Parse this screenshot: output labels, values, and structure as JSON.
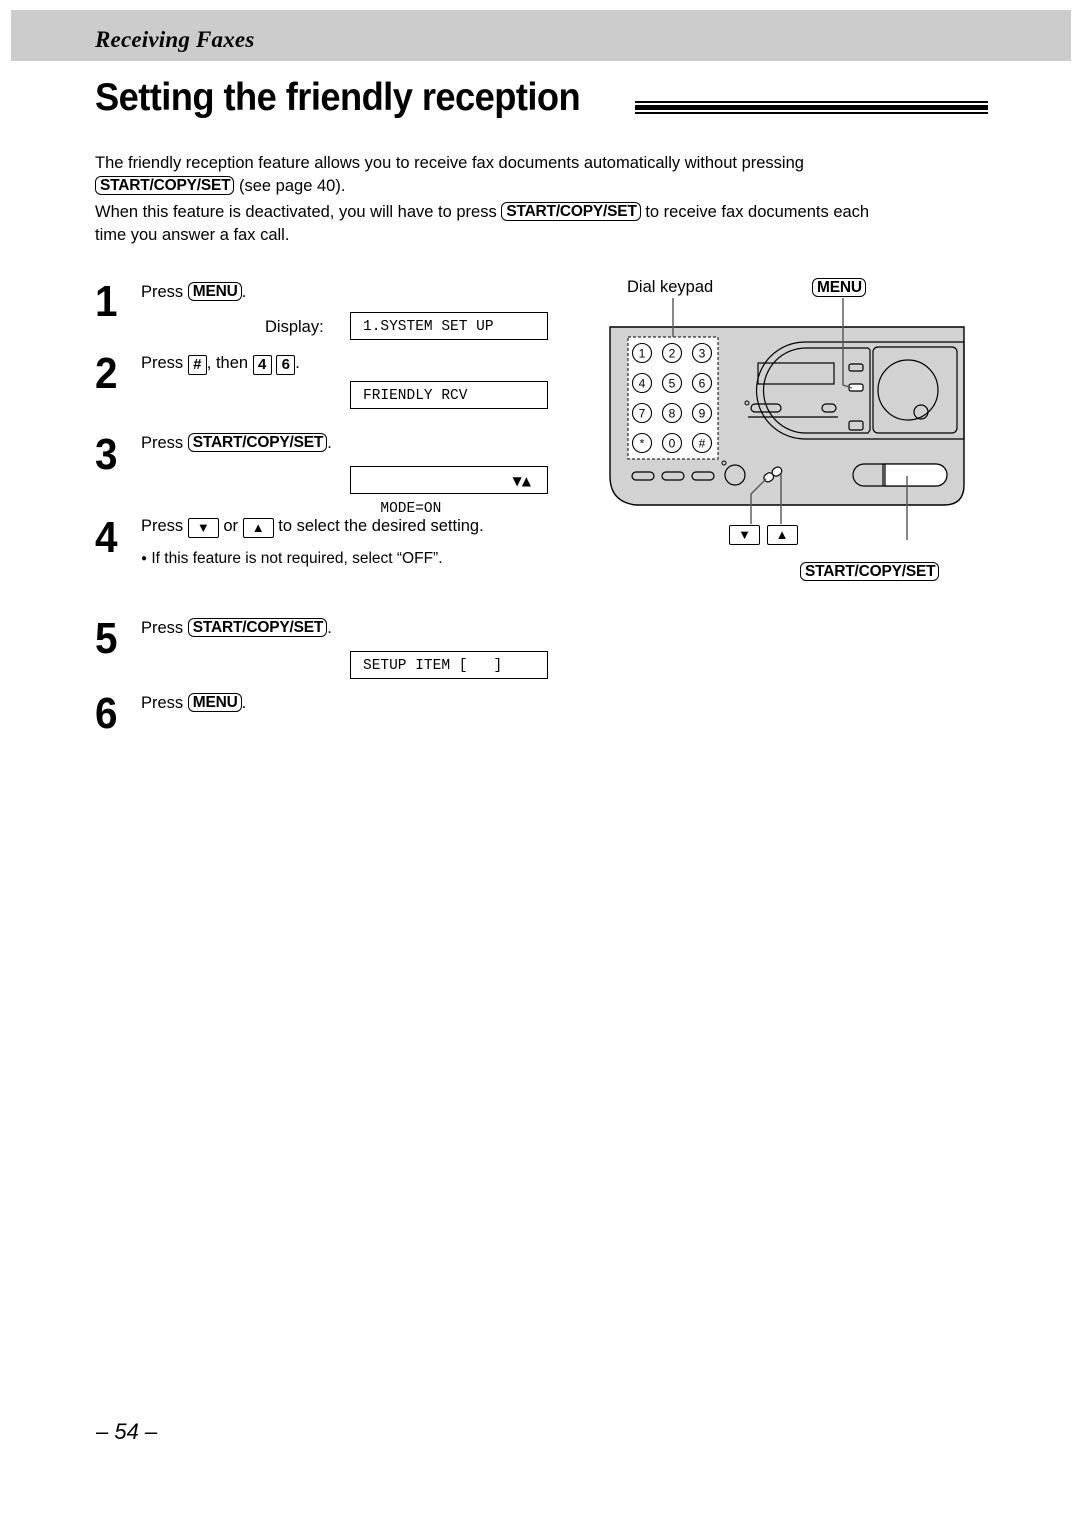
{
  "section": {
    "title": "Receiving Faxes"
  },
  "page_title": "Setting the friendly reception",
  "intro": {
    "line1": "The friendly reception feature allows you to receive fax documents automatically without pressing",
    "line2_key": "START/COPY/SET",
    "line2_text": "(see page 40).",
    "line3_pre": "When this feature is deactivated, you will have to press",
    "line3_key": "START/COPY/SET",
    "line3_post": "to receive fax documents each",
    "line4": "time you answer a fax call."
  },
  "steps": [
    {
      "number": "1",
      "press": "Press",
      "key": "MENU",
      "suffix": ".",
      "display_label": "Display:",
      "display": "1.SYSTEM SET UP"
    },
    {
      "number": "2",
      "press": "Press",
      "key": "#",
      "then": ", then",
      "key2": "4",
      "key3": "6",
      "suffix": ".",
      "display": "FRIENDLY RCV"
    },
    {
      "number": "3",
      "press": "Press",
      "key": "START/COPY/SET",
      "suffix": ".",
      "display": "MODE=ON",
      "display_arrows": "▼▲"
    },
    {
      "number": "4",
      "press": "Press",
      "key": "▼",
      "or": "or",
      "key2": "▲",
      "rest": "to select the desired setting.",
      "bullet": "●",
      "note": "If this feature is not required, select “OFF”."
    },
    {
      "number": "5",
      "press": "Press",
      "key": "START/COPY/SET",
      "suffix": ".",
      "display": "SETUP ITEM [   ]"
    },
    {
      "number": "6",
      "press": "Press",
      "key": "MENU",
      "suffix": "."
    }
  ],
  "diagram": {
    "dial_keypad_label": "Dial keypad",
    "menu_label": "MENU",
    "start_label": "START/COPY/SET",
    "down_key": "▼",
    "up_key": "▲",
    "keypad": [
      "1",
      "2",
      "3",
      "4",
      "5",
      "6",
      "7",
      "8",
      "9",
      "*",
      "0",
      "#"
    ],
    "panel_color": "#d2d2d2"
  },
  "page_number": "– 54 –"
}
